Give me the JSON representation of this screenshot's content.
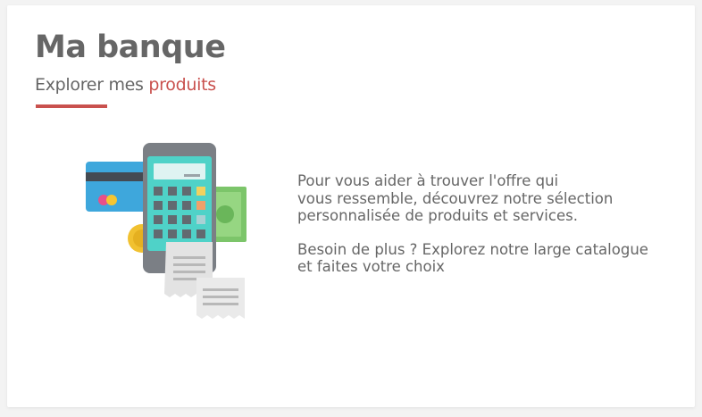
{
  "header": {
    "title": "Ma banque",
    "subtitle_prefix": "Explorer mes",
    "subtitle_accent": "produits"
  },
  "content": {
    "paragraph_1": "Pour vous aider à trouver l'offre qui\nvous ressemble, découvrez notre sélection\npersonnalisée de produits et services.",
    "paragraph_2": "Besoin de plus ? Explorez notre large catalogue\net faites votre choix"
  },
  "icons": {
    "illustration": "banking-calculator-illustration"
  },
  "colors": {
    "accent": "#c9514e",
    "text": "#666666"
  }
}
